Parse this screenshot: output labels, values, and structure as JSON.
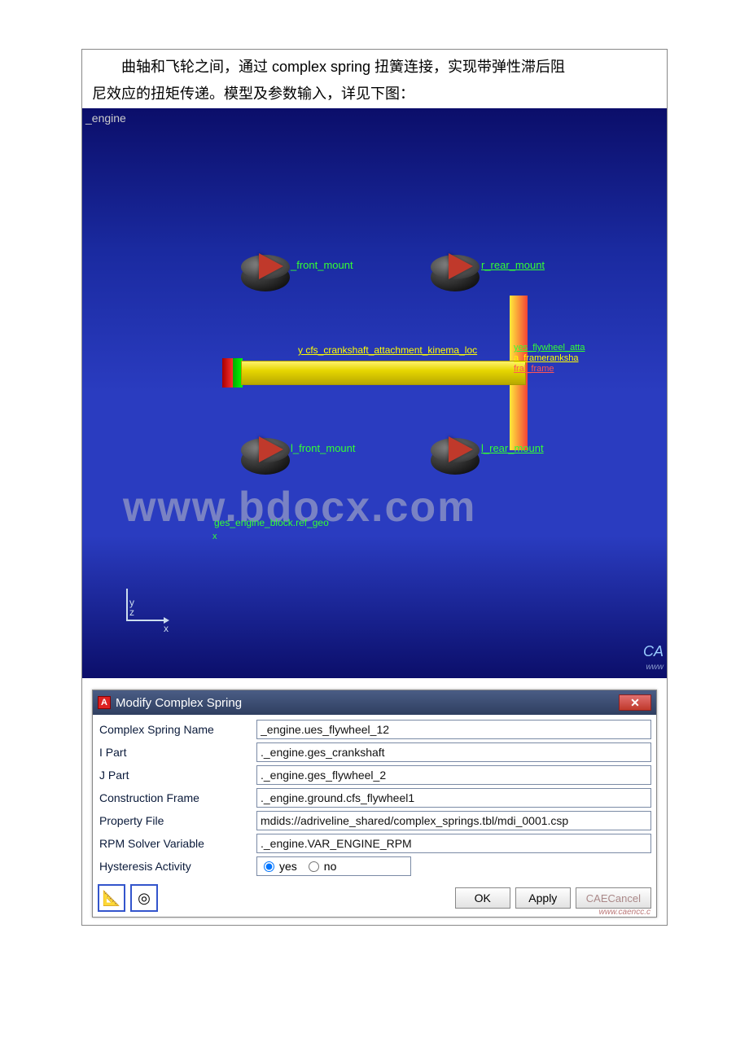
{
  "intro": {
    "line1": "曲轴和飞轮之间，通过 complex spring 扭簧连接，实现带弹性滞后阻",
    "line2": "尼效应的扭矩传递。模型及参数输入，详见下图："
  },
  "viewport": {
    "model_name": "_engine",
    "mounts": {
      "front_upper": "_front_mount",
      "rear_upper": "r_rear_mount",
      "front_lower": "l_front_mount",
      "rear_lower": "l_rear_mount"
    },
    "cfs_label": "y cfs_crankshaft_attachment_kinema_loc",
    "right_labels": {
      "l1": "yes_flywheel_atta",
      "l2": "a_frameranksha",
      "l3": "fral_frame"
    },
    "ges_label": "ges_engine_block.ref_geo",
    "coord_small_x": "x",
    "coord": {
      "x": "x",
      "y": "y",
      "z": "z"
    },
    "ca_label": "CA",
    "wm_small": "www",
    "watermark": "www.bdocx.com"
  },
  "dialog": {
    "title": "Modify Complex Spring",
    "icon_letter": "A",
    "fields": {
      "name_label": "Complex Spring Name",
      "name_value": "_engine.ues_flywheel_12",
      "ipart_label": "I Part",
      "ipart_value": "._engine.ges_crankshaft",
      "jpart_label": "J Part",
      "jpart_value": "._engine.ges_flywheel_2",
      "cframe_label": "Construction Frame",
      "cframe_value": "._engine.ground.cfs_flywheel1",
      "prop_label": "Property File",
      "prop_value": "mdids://adriveline_shared/complex_springs.tbl/mdi_0001.csp",
      "rpm_label": "RPM Solver Variable",
      "rpm_value": "._engine.VAR_ENGINE_RPM",
      "hyst_label": "Hysteresis Activity",
      "hyst_yes": "yes",
      "hyst_no": "no"
    },
    "buttons": {
      "ok": "OK",
      "apply": "Apply",
      "cancel": "Cancel",
      "cancel_overlay": "CAECancel"
    },
    "footer_wm": "www.caencc.c"
  }
}
